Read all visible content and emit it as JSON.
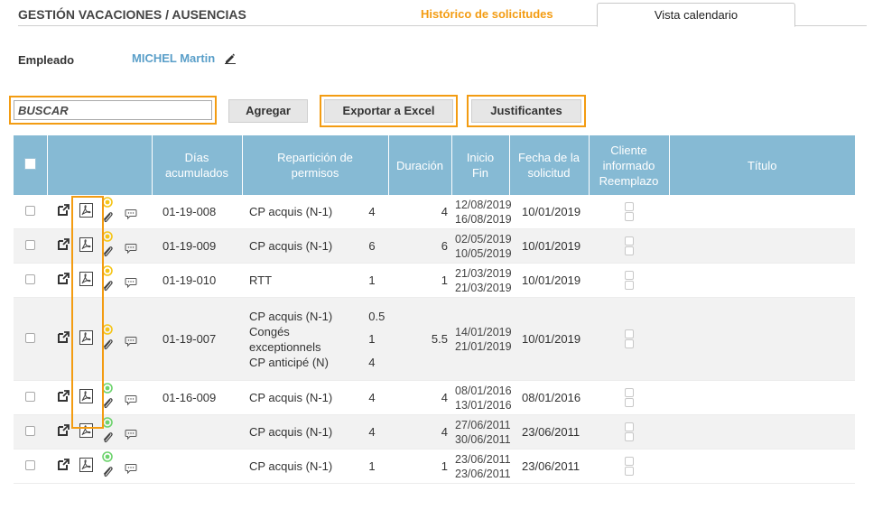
{
  "header": {
    "title": "GESTIÓN VACACIONES / AUSENCIAS",
    "tabs": [
      {
        "label": "Histórico de solicitudes",
        "active": true
      },
      {
        "label": "Vista calendario",
        "active": false
      }
    ]
  },
  "employee": {
    "label": "Empleado",
    "name": "MICHEL Martin"
  },
  "toolbar": {
    "search_placeholder": "BUSCAR",
    "add_label": "Agregar",
    "export_label": "Exportar a Excel",
    "justify_label": "Justificantes"
  },
  "table": {
    "headers": {
      "dias": [
        "Días",
        "acumulados"
      ],
      "reparticion": [
        "Repartición de",
        "permisos"
      ],
      "duracion": "Duración",
      "inicio_fin": [
        "Inicio",
        "Fin"
      ],
      "fecha": [
        "Fecha de la",
        "solicitud"
      ],
      "cliente": [
        "Cliente",
        "informado",
        "Reemplazo"
      ],
      "titulo": "Título"
    },
    "rows": [
      {
        "status": "pending",
        "ref": "01-19-008",
        "reparticion": [
          {
            "name": "CP acquis (N-1)",
            "value": "4"
          }
        ],
        "duracion": "4",
        "inicio": "12/08/2019",
        "fin": "16/08/2019",
        "fecha": "10/01/2019"
      },
      {
        "status": "pending",
        "ref": "01-19-009",
        "reparticion": [
          {
            "name": "CP acquis (N-1)",
            "value": "6"
          }
        ],
        "duracion": "6",
        "inicio": "02/05/2019",
        "fin": "10/05/2019",
        "fecha": "10/01/2019"
      },
      {
        "status": "pending",
        "ref": "01-19-010",
        "reparticion": [
          {
            "name": "RTT",
            "value": "1"
          }
        ],
        "duracion": "1",
        "inicio": "21/03/2019",
        "fin": "21/03/2019",
        "fecha": "10/01/2019"
      },
      {
        "status": "pending",
        "ref": "01-19-007",
        "reparticion": [
          {
            "name": "CP acquis (N-1)",
            "value": "0.5"
          },
          {
            "name": "Congés exceptionnels",
            "value": "1"
          },
          {
            "name": "CP anticipé (N)",
            "value": "4"
          }
        ],
        "duracion": "5.5",
        "inicio": "14/01/2019",
        "fin": "21/01/2019",
        "fecha": "10/01/2019"
      },
      {
        "status": "approved",
        "ref": "01-16-009",
        "reparticion": [
          {
            "name": "CP acquis (N-1)",
            "value": "4"
          }
        ],
        "duracion": "4",
        "inicio": "08/01/2016",
        "fin": "13/01/2016",
        "fecha": "08/01/2016"
      },
      {
        "status": "approved",
        "ref": "",
        "reparticion": [
          {
            "name": "CP acquis (N-1)",
            "value": "4"
          }
        ],
        "duracion": "4",
        "inicio": "27/06/2011",
        "fin": "30/06/2011",
        "fecha": "23/06/2011"
      },
      {
        "status": "approved",
        "ref": "",
        "reparticion": [
          {
            "name": "CP acquis (N-1)",
            "value": "1"
          }
        ],
        "duracion": "1",
        "inicio": "23/06/2011",
        "fin": "23/06/2011",
        "fecha": "23/06/2011"
      }
    ]
  },
  "colors": {
    "accent": "#f39c12",
    "header_bg": "#86bad4",
    "link": "#5a9fc9",
    "status_pending": "#f5c518",
    "status_approved": "#6dd36d"
  },
  "icons": [
    "pencil-icon",
    "open-external-icon",
    "pdf-icon",
    "status-dot-icon",
    "paperclip-icon",
    "comment-icon"
  ]
}
